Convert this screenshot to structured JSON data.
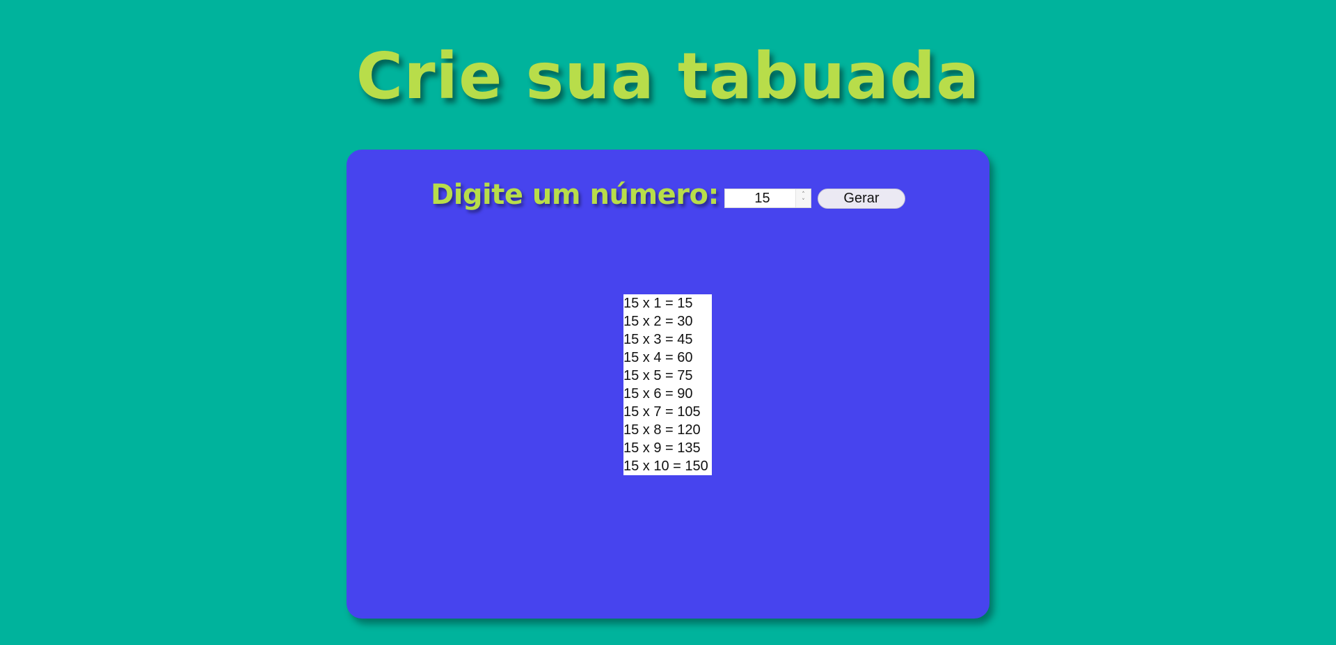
{
  "page": {
    "title": "Crie sua tabuada"
  },
  "form": {
    "prompt_label": "Digite um número:",
    "number_value": "15",
    "generate_label": "Gerar"
  },
  "result": {
    "lines": [
      "15 x 1 = 15",
      "15 x 2 = 30",
      "15 x 3 = 45",
      "15 x 4 = 60",
      "15 x 5 = 75",
      "15 x 6 = 90",
      "15 x 7 = 105",
      "15 x 8 = 120",
      "15 x 9 = 135",
      "15 x 10 = 150"
    ]
  },
  "colors": {
    "background": "#00b39c",
    "panel": "#4744ee",
    "accent_text": "#b8dd4a"
  }
}
